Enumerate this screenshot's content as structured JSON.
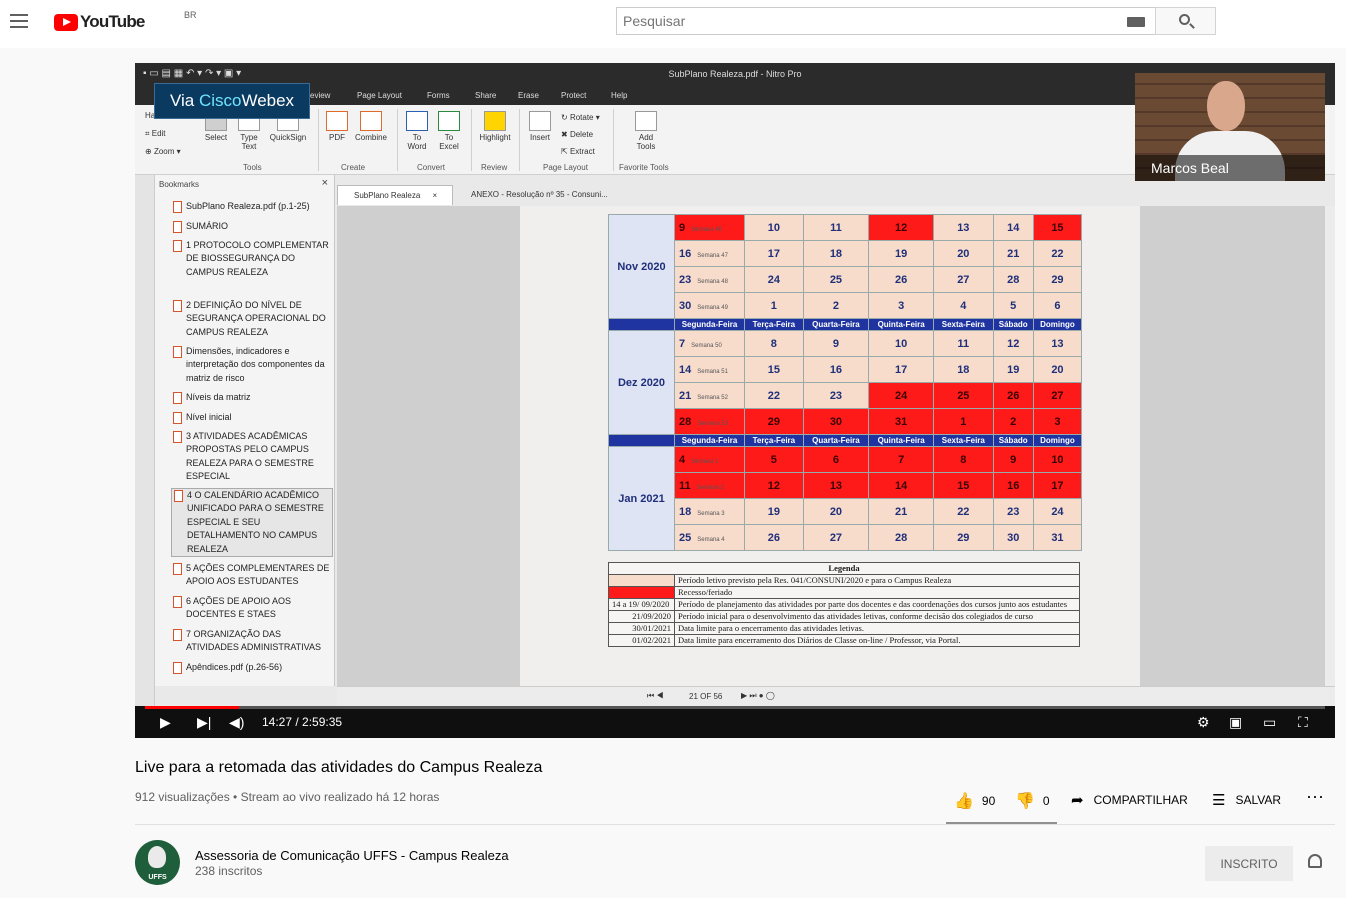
{
  "header": {
    "logo_text": "YouTube",
    "logo_region": "BR",
    "search_placeholder": "Pesquisar"
  },
  "nitro": {
    "window_title": "SubPlano Realeza.pdf - Nitro Pro",
    "menu": [
      "eview",
      "Page Layout",
      "Forms",
      "Share",
      "Erase",
      "Protect",
      "Help"
    ],
    "webex_label": "Via ",
    "webex_brand": "Cisco",
    "webex_tail": "Webex",
    "ribbon": {
      "hand": "Hand",
      "edit": "Edit",
      "zoom": "Zoom ▾",
      "select": "Select",
      "type_text": "Type Text",
      "quicksign": "QuickSign",
      "tools": "Tools",
      "pdf": "PDF",
      "combine": "Combine",
      "create": "Create",
      "to_word": "To Word",
      "to_excel": "To Excel",
      "convert": "Convert",
      "highlight": "Highlight",
      "review": "Review",
      "insert": "Insert",
      "rotate": "Rotate ▾",
      "delete": "Delete",
      "extract": "Extract",
      "page_layout": "Page Layout",
      "add_tools": "Add Tools",
      "favorite_tools": "Favorite Tools"
    },
    "bookmarks_title": "Bookmarks",
    "bookmarks": [
      "SubPlano Realeza.pdf (p.1-25)",
      "SUMÁRIO",
      "1 PROTOCOLO COMPLEMENTAR DE BIOSSEGURANÇA DO CAMPUS REALEZA",
      "2 DEFINIÇÃO DO NÍVEL DE SEGURANÇA OPERACIONAL DO CAMPUS REALEZA",
      "Dimensões, indicadores e interpretação dos componentes da matriz de risco",
      "Níveis da matriz",
      "Nível inicial",
      "3 ATIVIDADES ACADÊMICAS PROPOSTAS PELO CAMPUS REALEZA PARA O SEMESTRE ESPECIAL",
      "4 O CALENDÁRIO ACADÊMICO UNIFICADO PARA O SEMESTRE ESPECIAL E SEU DETALHAMENTO NO CAMPUS REALEZA",
      "5 AÇÕES COMPLEMENTARES DE APOIO AOS ESTUDANTES",
      "6 AÇÕES DE APOIO AOS DOCENTES E STAES",
      "7 ORGANIZAÇÃO DAS ATIVIDADES ADMINISTRATIVAS",
      "Apêndices.pdf (p.26-56)"
    ],
    "tabs": [
      "SubPlano Realeza",
      "ANEXO - Resolução nº 35 - Consuni..."
    ],
    "page_indicator": "21 OF 56",
    "weekdays": [
      "Segunda-Feira",
      "Terça-Feira",
      "Quarta-Feira",
      "Quinta-Feira",
      "Sexta-Feira",
      "Sábado",
      "Domingo"
    ],
    "months": {
      "nov": "Nov 2020",
      "dez": "Dez 2020",
      "jan": "Jan 2021"
    },
    "legend_title": "Legenda",
    "legend": [
      {
        "date": "",
        "text": "Período letivo previsto pela Res. 041/CONSUNI/2020 e para o Campus Realeza"
      },
      {
        "date": "",
        "text": "Recesso/feriado"
      },
      {
        "date": "14 a 19/ 09/2020",
        "text": "Período de planejamento das atividades por parte dos docentes e das coordenações dos cursos junto aos estudantes"
      },
      {
        "date": "21/09/2020",
        "text": "Período inicial para o desenvolvimento das atividades letivas, conforme decisão dos colegiados de curso"
      },
      {
        "date": "30/01/2021",
        "text": "Data limite para o encerramento das atividades letivas."
      },
      {
        "date": "01/02/2021",
        "text": "Data limite para encerramento dos Diários de Classe on-line / Professor, via Portal."
      }
    ],
    "webcam_name": "Marcos Beal"
  },
  "player": {
    "time_current": "14:27",
    "time_total": "2:59:35",
    "progress": 0.08
  },
  "video": {
    "title": "Live para a retomada das atividades do Campus Realeza",
    "meta": "912 visualizações • Stream ao vivo realizado há 12 horas",
    "likes": "90",
    "dislikes": "0",
    "share": "COMPARTILHAR",
    "save": "SALVAR"
  },
  "channel": {
    "name": "Assessoria de Comunicação UFFS - Campus Realeza",
    "subscribers": "238 inscritos",
    "subscribe_label": "INSCRITO"
  }
}
